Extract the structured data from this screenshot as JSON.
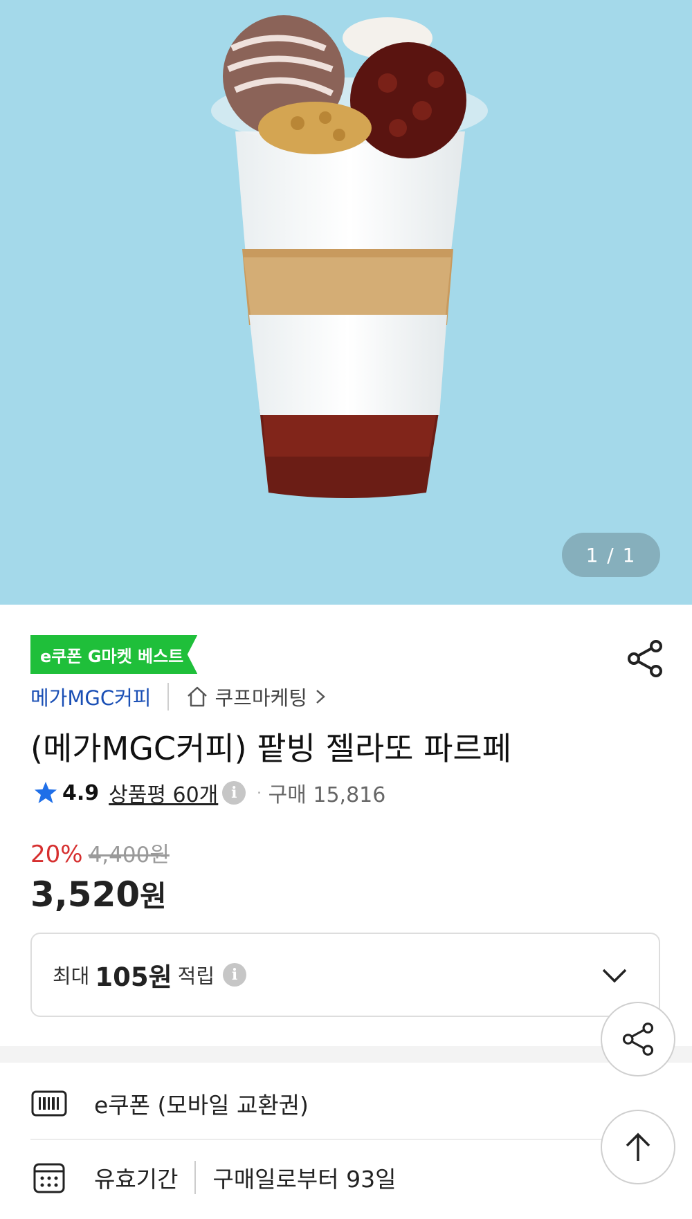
{
  "hero": {
    "page_indicator": "1 / 1"
  },
  "product": {
    "badge": "e쿠폰 G마켓 베스트",
    "brand": "메가MGC커피",
    "store": "쿠프마케팅",
    "title": "(메가MGC커피) 팥빙 젤라또 파르페",
    "rating": "4.9",
    "review_link": "상품평 60개",
    "info_glyph": "i",
    "purchase_count": "구매 15,816",
    "discount": "20%",
    "original_price": "4,400원",
    "price": "3,520",
    "price_unit": "원"
  },
  "points": {
    "prefix": "최대",
    "amount": "105원",
    "suffix": "적립"
  },
  "details": {
    "type_label": "e쿠폰 (모바일 교환권)",
    "validity_label": "유효기간",
    "validity_value": "구매일로부터 93일"
  },
  "icons": {
    "share": "share-icon",
    "home": "home-icon",
    "star": "star-icon",
    "info": "info-icon",
    "chevron_down": "chevron-down-icon",
    "barcode": "barcode-icon",
    "calendar": "calendar-icon",
    "arrow_up": "arrow-up-icon"
  },
  "colors": {
    "hero_bg": "#a4d9ea",
    "badge_green": "#1fbf3a",
    "brand_blue": "#1a4fb5",
    "discount_red": "#d62f2f",
    "star_blue": "#1f6fe8"
  }
}
